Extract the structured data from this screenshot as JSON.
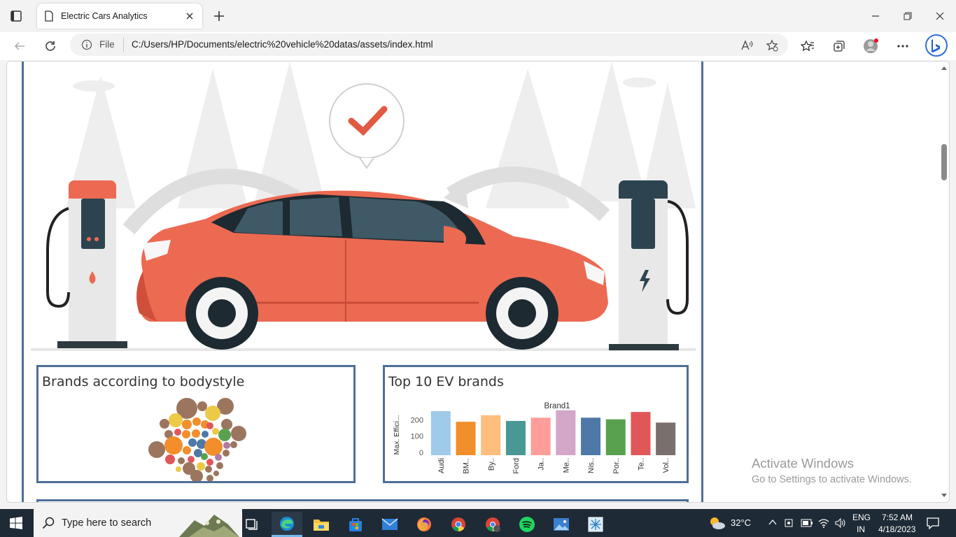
{
  "browser": {
    "tab_title": "Electric Cars Analytics",
    "address_scheme": "File",
    "address_url": "C:/Users/HP/Documents/electric%20vehicle%20datas/assets/index.html"
  },
  "dashboard": {
    "panel_left_title": "Brands according to bodystyle",
    "panel_right_title": "Top 10 EV brands"
  },
  "chart_data": [
    {
      "type": "scatter",
      "title": "Brands according to bodystyle",
      "note": "packed bubble chart"
    },
    {
      "type": "bar",
      "title": "Top 10 EV brands",
      "legend_title": "Brand1",
      "ylabel": "Max. Effici...",
      "categories": [
        "Audi",
        "BM..",
        "By..",
        "Ford",
        "Ja..",
        "Me..",
        "Nis..",
        "Por..",
        "Te..",
        "Vol.."
      ],
      "values": [
        270,
        205,
        245,
        210,
        230,
        275,
        230,
        220,
        265,
        200
      ],
      "yticks": [
        "0",
        "100",
        "200"
      ],
      "ylim": [
        0,
        300
      ],
      "colors": [
        "#a0cbe8",
        "#f28e2b",
        "#ffbe7d",
        "#499894",
        "#ff9d9a",
        "#d4a6c8",
        "#4e79a7",
        "#59a14f",
        "#e15759",
        "#79706e"
      ]
    }
  ],
  "watermark": {
    "line1": "Activate Windows",
    "line2": "Go to Settings to activate Windows."
  },
  "taskbar": {
    "search_placeholder": "Type here to search",
    "weather": "32°C",
    "lang_line1": "ENG",
    "lang_line2": "IN",
    "time": "7:52 AM",
    "date": "4/18/2023"
  }
}
